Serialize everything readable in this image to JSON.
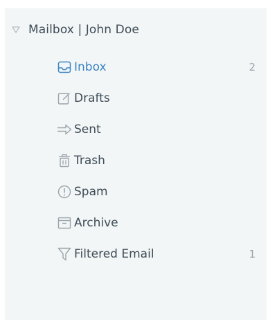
{
  "mailbox": {
    "title": "Mailbox | John Doe",
    "expanded": true,
    "caret_icon": "triangle-down-icon"
  },
  "colors": {
    "panel_bg": "#f3f6f6",
    "text": "#3e4c57",
    "active_text": "#3b84c4",
    "icon": "#9aa4ab",
    "count": "#9aa4ab"
  },
  "folders": [
    {
      "label": "Inbox",
      "icon": "inbox-icon",
      "count": "2",
      "active": true
    },
    {
      "label": "Drafts",
      "icon": "edit-icon",
      "count": "",
      "active": false
    },
    {
      "label": "Sent",
      "icon": "arrow-right-icon",
      "count": "",
      "active": false
    },
    {
      "label": "Trash",
      "icon": "trash-icon",
      "count": "",
      "active": false
    },
    {
      "label": "Spam",
      "icon": "alert-circle-icon",
      "count": "",
      "active": false
    },
    {
      "label": "Archive",
      "icon": "archive-icon",
      "count": "",
      "active": false
    },
    {
      "label": "Filtered Email",
      "icon": "filter-icon",
      "count": "1",
      "active": false
    }
  ]
}
